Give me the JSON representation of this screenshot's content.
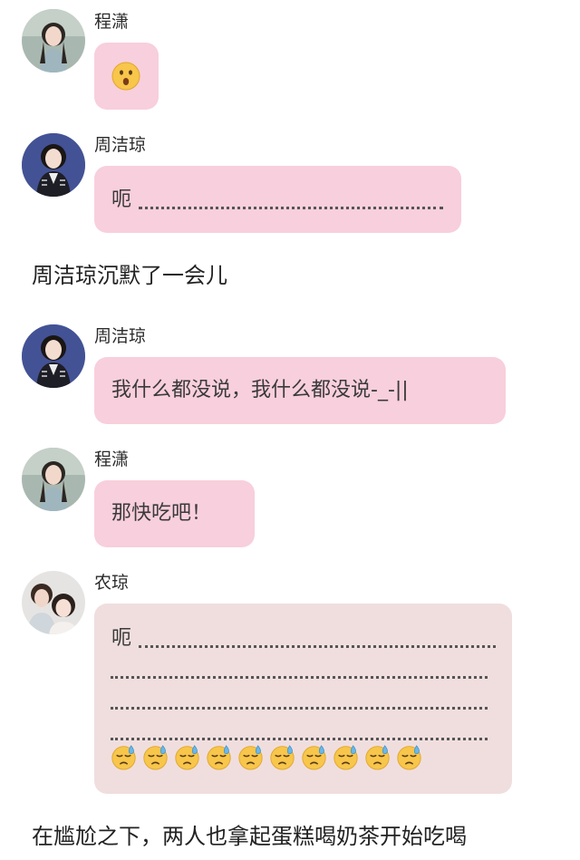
{
  "messages": [
    {
      "sender": "程潇",
      "text": "😮",
      "avatar": "girl-light-dress-avatar"
    },
    {
      "sender": "周洁琼",
      "text": "呃",
      "avatar": "girl-dark-jacket-avatar"
    },
    {
      "sender": "周洁琼",
      "text": "我什么都没说，我什么都没说-_-||",
      "avatar": "girl-dark-jacket-avatar"
    },
    {
      "sender": "程潇",
      "text": "那快吃吧！",
      "avatar": "girl-light-dress-avatar"
    },
    {
      "sender": "农琼",
      "text": "呃",
      "avatar": "couple-avatar",
      "emoji": "downcast-sweat-face",
      "emoji_count": 10
    }
  ],
  "narration": [
    "周洁琼沉默了一会儿",
    "在尴尬之下，两人也拿起蛋糕喝奶茶开始吃喝"
  ],
  "colors": {
    "bubble": "#f8cfdc",
    "bubble_light": "#f0dede",
    "background": "#ffffff"
  }
}
